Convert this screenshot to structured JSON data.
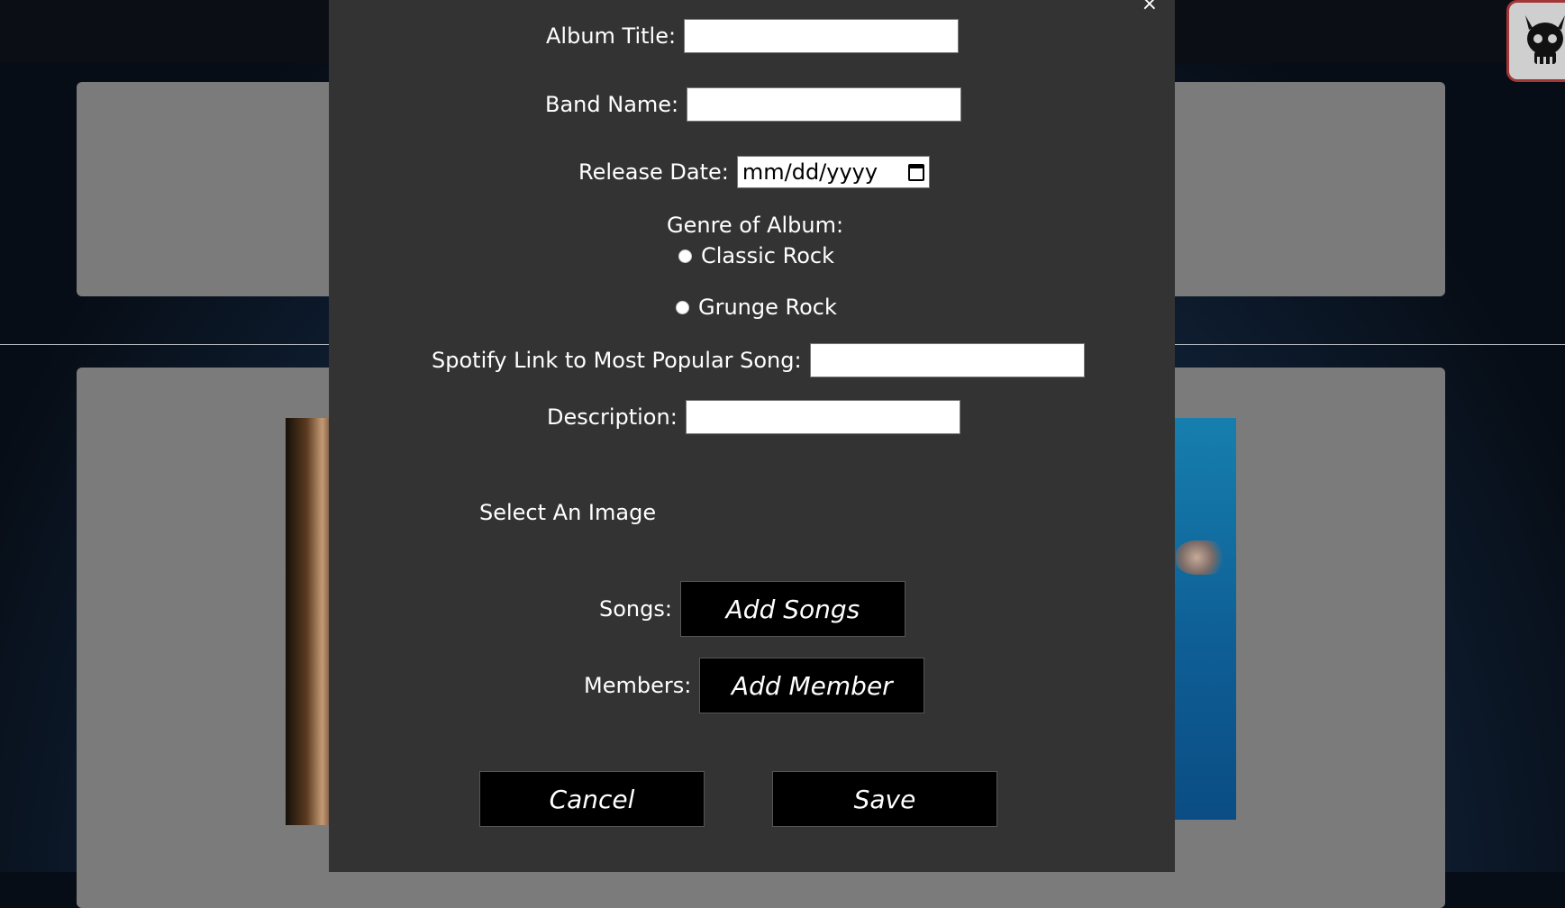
{
  "form": {
    "album_title_label": "Album Title:",
    "band_name_label": "Band Name:",
    "release_date_label": "Release Date:",
    "release_date_placeholder": "mm/dd/yyyy",
    "genre_label": "Genre of Album:",
    "genre_options": [
      "Classic Rock",
      "Grunge Rock"
    ],
    "spotify_label": "Spotify Link to Most Popular Song:",
    "description_label": "Description:",
    "select_image_label": "Select An Image",
    "songs_label": "Songs:",
    "add_songs_button": "Add Songs",
    "members_label": "Members:",
    "add_member_button": "Add Member",
    "cancel_button": "Cancel",
    "save_button": "Save",
    "close_glyph": "×"
  },
  "icons": {
    "close": "close-icon",
    "calendar": "calendar-icon",
    "logo": "skull-logo-icon"
  },
  "colors": {
    "modal_bg": "#333333",
    "button_bg": "#000000",
    "card_bg": "#7b7b7b",
    "logo_border": "#a33636"
  }
}
